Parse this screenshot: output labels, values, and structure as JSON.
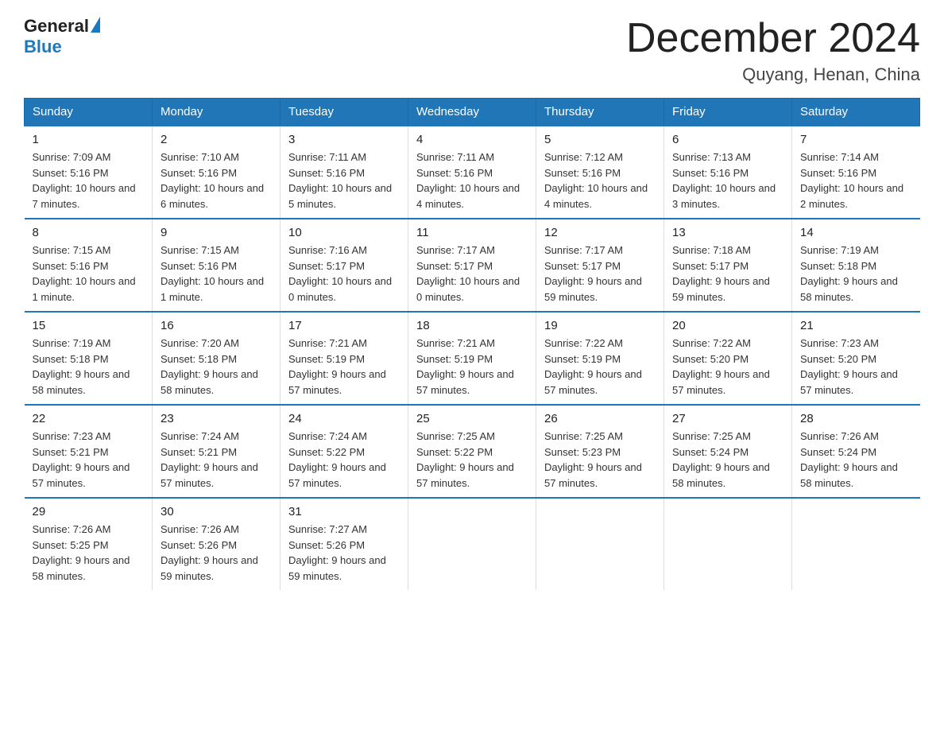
{
  "header": {
    "logo": {
      "general": "General",
      "blue": "Blue"
    },
    "title": "December 2024",
    "location": "Quyang, Henan, China"
  },
  "columns": [
    "Sunday",
    "Monday",
    "Tuesday",
    "Wednesday",
    "Thursday",
    "Friday",
    "Saturday"
  ],
  "weeks": [
    [
      {
        "day": "1",
        "sunrise": "7:09 AM",
        "sunset": "5:16 PM",
        "daylight": "10 hours and 7 minutes."
      },
      {
        "day": "2",
        "sunrise": "7:10 AM",
        "sunset": "5:16 PM",
        "daylight": "10 hours and 6 minutes."
      },
      {
        "day": "3",
        "sunrise": "7:11 AM",
        "sunset": "5:16 PM",
        "daylight": "10 hours and 5 minutes."
      },
      {
        "day": "4",
        "sunrise": "7:11 AM",
        "sunset": "5:16 PM",
        "daylight": "10 hours and 4 minutes."
      },
      {
        "day": "5",
        "sunrise": "7:12 AM",
        "sunset": "5:16 PM",
        "daylight": "10 hours and 4 minutes."
      },
      {
        "day": "6",
        "sunrise": "7:13 AM",
        "sunset": "5:16 PM",
        "daylight": "10 hours and 3 minutes."
      },
      {
        "day": "7",
        "sunrise": "7:14 AM",
        "sunset": "5:16 PM",
        "daylight": "10 hours and 2 minutes."
      }
    ],
    [
      {
        "day": "8",
        "sunrise": "7:15 AM",
        "sunset": "5:16 PM",
        "daylight": "10 hours and 1 minute."
      },
      {
        "day": "9",
        "sunrise": "7:15 AM",
        "sunset": "5:16 PM",
        "daylight": "10 hours and 1 minute."
      },
      {
        "day": "10",
        "sunrise": "7:16 AM",
        "sunset": "5:17 PM",
        "daylight": "10 hours and 0 minutes."
      },
      {
        "day": "11",
        "sunrise": "7:17 AM",
        "sunset": "5:17 PM",
        "daylight": "10 hours and 0 minutes."
      },
      {
        "day": "12",
        "sunrise": "7:17 AM",
        "sunset": "5:17 PM",
        "daylight": "9 hours and 59 minutes."
      },
      {
        "day": "13",
        "sunrise": "7:18 AM",
        "sunset": "5:17 PM",
        "daylight": "9 hours and 59 minutes."
      },
      {
        "day": "14",
        "sunrise": "7:19 AM",
        "sunset": "5:18 PM",
        "daylight": "9 hours and 58 minutes."
      }
    ],
    [
      {
        "day": "15",
        "sunrise": "7:19 AM",
        "sunset": "5:18 PM",
        "daylight": "9 hours and 58 minutes."
      },
      {
        "day": "16",
        "sunrise": "7:20 AM",
        "sunset": "5:18 PM",
        "daylight": "9 hours and 58 minutes."
      },
      {
        "day": "17",
        "sunrise": "7:21 AM",
        "sunset": "5:19 PM",
        "daylight": "9 hours and 57 minutes."
      },
      {
        "day": "18",
        "sunrise": "7:21 AM",
        "sunset": "5:19 PM",
        "daylight": "9 hours and 57 minutes."
      },
      {
        "day": "19",
        "sunrise": "7:22 AM",
        "sunset": "5:19 PM",
        "daylight": "9 hours and 57 minutes."
      },
      {
        "day": "20",
        "sunrise": "7:22 AM",
        "sunset": "5:20 PM",
        "daylight": "9 hours and 57 minutes."
      },
      {
        "day": "21",
        "sunrise": "7:23 AM",
        "sunset": "5:20 PM",
        "daylight": "9 hours and 57 minutes."
      }
    ],
    [
      {
        "day": "22",
        "sunrise": "7:23 AM",
        "sunset": "5:21 PM",
        "daylight": "9 hours and 57 minutes."
      },
      {
        "day": "23",
        "sunrise": "7:24 AM",
        "sunset": "5:21 PM",
        "daylight": "9 hours and 57 minutes."
      },
      {
        "day": "24",
        "sunrise": "7:24 AM",
        "sunset": "5:22 PM",
        "daylight": "9 hours and 57 minutes."
      },
      {
        "day": "25",
        "sunrise": "7:25 AM",
        "sunset": "5:22 PM",
        "daylight": "9 hours and 57 minutes."
      },
      {
        "day": "26",
        "sunrise": "7:25 AM",
        "sunset": "5:23 PM",
        "daylight": "9 hours and 57 minutes."
      },
      {
        "day": "27",
        "sunrise": "7:25 AM",
        "sunset": "5:24 PM",
        "daylight": "9 hours and 58 minutes."
      },
      {
        "day": "28",
        "sunrise": "7:26 AM",
        "sunset": "5:24 PM",
        "daylight": "9 hours and 58 minutes."
      }
    ],
    [
      {
        "day": "29",
        "sunrise": "7:26 AM",
        "sunset": "5:25 PM",
        "daylight": "9 hours and 58 minutes."
      },
      {
        "day": "30",
        "sunrise": "7:26 AM",
        "sunset": "5:26 PM",
        "daylight": "9 hours and 59 minutes."
      },
      {
        "day": "31",
        "sunrise": "7:27 AM",
        "sunset": "5:26 PM",
        "daylight": "9 hours and 59 minutes."
      },
      null,
      null,
      null,
      null
    ]
  ]
}
